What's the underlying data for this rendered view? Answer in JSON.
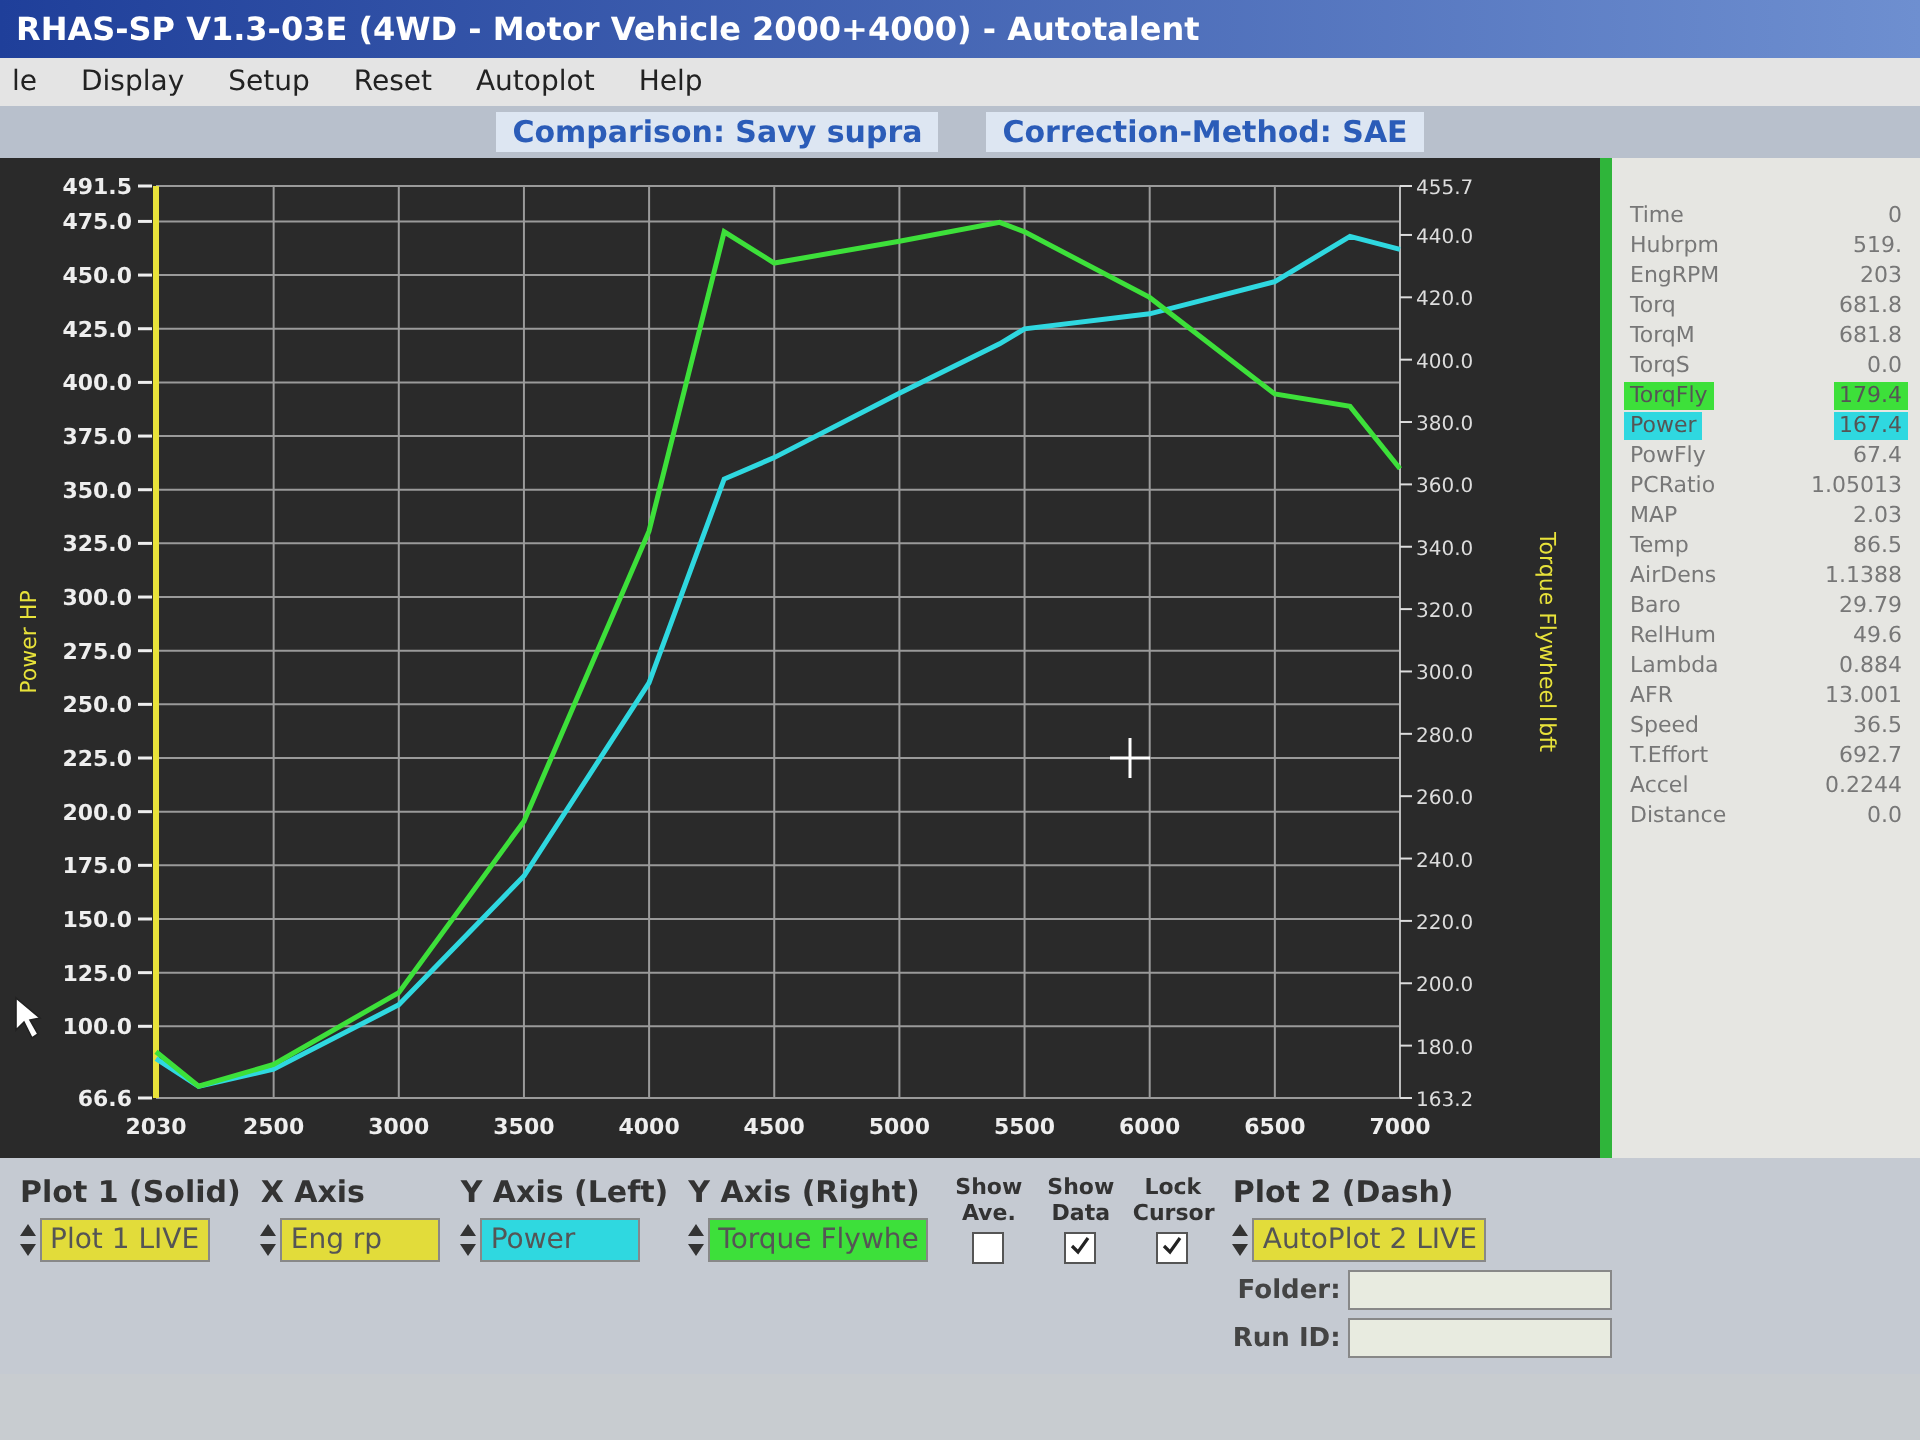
{
  "window": {
    "title": "RHAS-SP V1.3-03E  (4WD - Motor Vehicle 2000+4000) - Autotalent"
  },
  "menu": [
    "le",
    "Display",
    "Setup",
    "Reset",
    "Autoplot",
    "Help"
  ],
  "header": {
    "comparison": "Comparison: Savy supra",
    "correction": "Correction-Method: SAE"
  },
  "chart": {
    "chart_data": {
      "type": "line",
      "grid": true,
      "ylabel": "Power HP",
      "y2label": "Torque Flywheel lbft",
      "y2lim": [
        163.2,
        455.7
      ],
      "y2ticks": [
        {
          "value": 163.2,
          "label": "163.2"
        },
        {
          "value": 180,
          "label": "180.0"
        },
        {
          "value": 200,
          "label": "200.0"
        },
        {
          "value": 220,
          "label": "220.0"
        },
        {
          "value": 240,
          "label": "240.0"
        },
        {
          "value": 260,
          "label": "260.0"
        },
        {
          "value": 280,
          "label": "280.0"
        },
        {
          "value": 300,
          "label": "300.0"
        },
        {
          "value": 320,
          "label": "320.0"
        },
        {
          "value": 340,
          "label": "340.0"
        },
        {
          "value": 360,
          "label": "360.0"
        },
        {
          "value": 380,
          "label": "380.0"
        },
        {
          "value": 400,
          "label": "400.0"
        },
        {
          "value": 420,
          "label": "420.0"
        },
        {
          "value": 440,
          "label": "440.0"
        },
        {
          "value": 455.7,
          "label": "455.7"
        }
      ],
      "x": [
        2030,
        2200,
        2500,
        3000,
        3500,
        4000,
        4300,
        4500,
        5000,
        5400,
        5500,
        6000,
        6500,
        6800,
        7000
      ],
      "xlim": [
        2030,
        7000
      ],
      "ylim": [
        66.6,
        491.5
      ],
      "xticks": [
        2030,
        2500,
        3000,
        3500,
        4000,
        4500,
        5000,
        5500,
        6000,
        6500,
        7000
      ],
      "yticks": [
        {
          "value": 66.6,
          "label": "66.6"
        },
        {
          "value": 100,
          "label": "100.0"
        },
        {
          "value": 125,
          "label": "125.0"
        },
        {
          "value": 150,
          "label": "150.0"
        },
        {
          "value": 175,
          "label": "175.0"
        },
        {
          "value": 200,
          "label": "200.0"
        },
        {
          "value": 225,
          "label": "225.0"
        },
        {
          "value": 250,
          "label": "250.0"
        },
        {
          "value": 275,
          "label": "275.0"
        },
        {
          "value": 300,
          "label": "300.0"
        },
        {
          "value": 325,
          "label": "325.0"
        },
        {
          "value": 350,
          "label": "350.0"
        },
        {
          "value": 375,
          "label": "375.0"
        },
        {
          "value": 400,
          "label": "400.0"
        },
        {
          "value": 425,
          "label": "425.0"
        },
        {
          "value": 450,
          "label": "450.0"
        },
        {
          "value": 475,
          "label": "475.0"
        },
        {
          "value": 491.5,
          "label": "491.5"
        }
      ],
      "series": [
        {
          "color": "#2fd8e0",
          "values": [
            85,
            72,
            80,
            110,
            170,
            260,
            355,
            365,
            395,
            418,
            425,
            432,
            447,
            468,
            462
          ]
        },
        {
          "axis": "y2",
          "color": "#3de03a",
          "values": [
            178,
            167,
            174,
            197,
            252,
            345,
            441,
            431,
            438,
            444,
            441,
            420,
            389,
            385,
            365
          ]
        }
      ]
    }
  },
  "readouts": [
    {
      "name": "Time",
      "value": "0"
    },
    {
      "name": "Hubrpm",
      "value": "519."
    },
    {
      "name": "EngRPM",
      "value": "203"
    },
    {
      "name": "Torq",
      "value": "681.8"
    },
    {
      "name": "TorqM",
      "value": "681.8"
    },
    {
      "name": "TorqS",
      "value": "0.0"
    },
    {
      "name": "TorqFly",
      "value": "179.4",
      "color": "#3de03a"
    },
    {
      "name": "Power",
      "value": "167.4",
      "color": "#2fd8e0"
    },
    {
      "name": "PowFly",
      "value": "67.4"
    },
    {
      "name": "PCRatio",
      "value": "1.05013"
    },
    {
      "name": "MAP",
      "value": "2.03"
    },
    {
      "name": "Temp",
      "value": "86.5"
    },
    {
      "name": "AirDens",
      "value": "1.1388"
    },
    {
      "name": "Baro",
      "value": "29.79"
    },
    {
      "name": "RelHum",
      "value": "49.6"
    },
    {
      "name": "Lambda",
      "value": "0.884"
    },
    {
      "name": "AFR",
      "value": "13.001"
    },
    {
      "name": "Speed",
      "value": "36.5"
    },
    {
      "name": "T.Effort",
      "value": "692.7"
    },
    {
      "name": "Accel",
      "value": "0.2244"
    },
    {
      "name": "Distance",
      "value": "0.0"
    }
  ],
  "selectors": [
    {
      "label": "Plot 1 (Solid)",
      "value": "Plot 1 LIVE",
      "color": "#e2dc3a"
    },
    {
      "label": "X Axis",
      "value": "Eng rp",
      "color": "#e2dc3a"
    },
    {
      "label": "Y Axis (Left)",
      "value": "Power",
      "color": "#2fd8e0"
    },
    {
      "label": "Y Axis (Right)",
      "value": "Torque Flywhe",
      "color": "#3de03a"
    },
    {
      "label": "Plot 2 (Dash)",
      "value": "AutoPlot 2 LIVE",
      "color": "#e2dc3a"
    }
  ],
  "checkboxes": [
    {
      "label": "Show Ave.",
      "checked": false
    },
    {
      "label": "Show Data",
      "checked": true
    },
    {
      "label": "Lock Cursor",
      "checked": true
    }
  ],
  "fields": [
    {
      "label": "Folder:"
    },
    {
      "label": "Run ID:"
    }
  ]
}
